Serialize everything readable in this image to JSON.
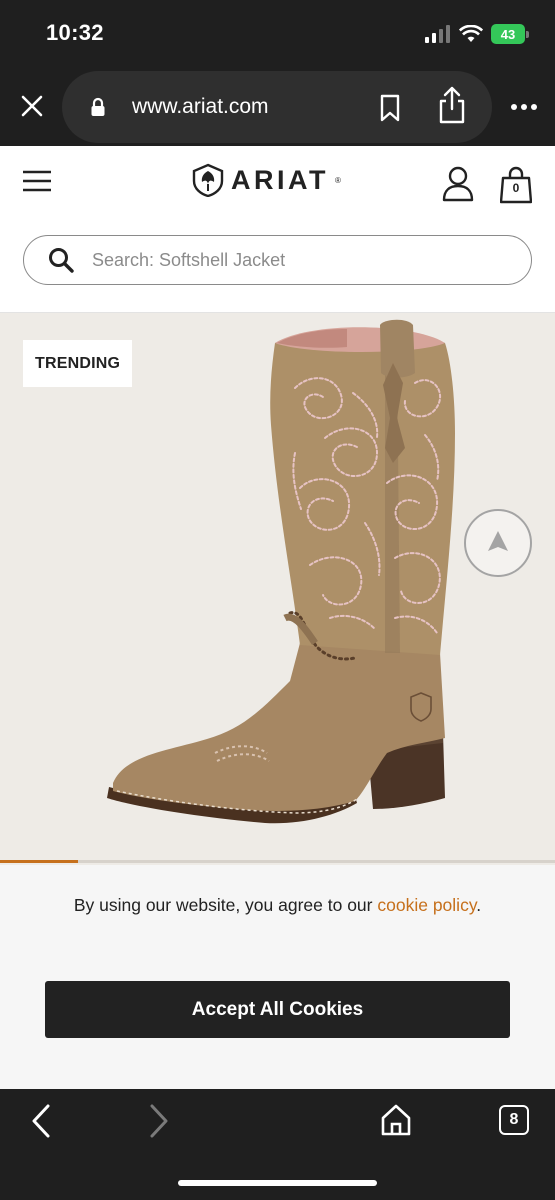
{
  "status_bar": {
    "time": "10:32",
    "battery": "43"
  },
  "browser": {
    "url": "www.ariat.com",
    "tab_count": "8"
  },
  "header": {
    "brand": "ARIAT",
    "brand_tm": "®",
    "bag_count": "0"
  },
  "search": {
    "placeholder": "Search: Softshell Jacket"
  },
  "hero": {
    "badge": "TRENDING",
    "carousel_progress": 0.14
  },
  "cookie": {
    "message": "By using our website, you agree to our",
    "link_text": "cookie policy",
    "period": ".",
    "accept_label": "Accept All Cookies"
  },
  "colors": {
    "accent": "#c6701c",
    "dark": "#1f1f1f",
    "button": "#222222"
  },
  "icons": [
    "close-icon",
    "lock-icon",
    "bookmark-icon",
    "share-icon",
    "more-icon",
    "menu-icon",
    "account-icon",
    "bag-icon",
    "search-icon",
    "scroll-top-icon",
    "back-icon",
    "forward-icon",
    "home-icon",
    "tabs-icon"
  ]
}
